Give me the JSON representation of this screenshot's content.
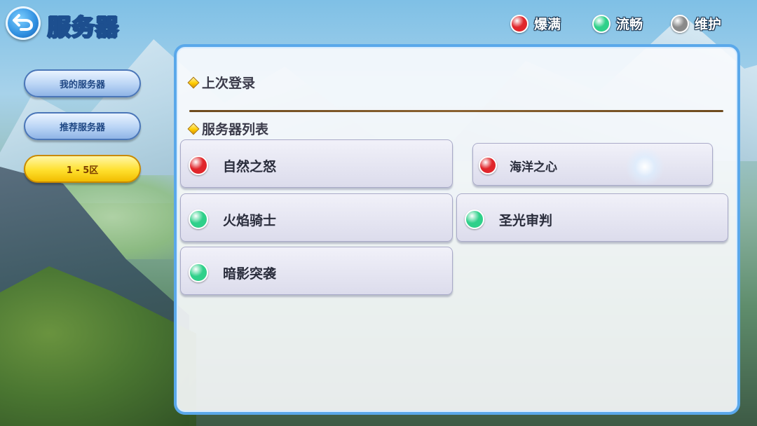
{
  "header": {
    "title": "服务器"
  },
  "legend": [
    {
      "label": "爆满",
      "color": "#e0262b"
    },
    {
      "label": "流畅",
      "color": "#2fd08a"
    },
    {
      "label": "维护",
      "color": "#8a8a8a"
    }
  ],
  "sidebar": {
    "items": [
      {
        "label": "我的服务器",
        "active": false
      },
      {
        "label": "推荐服务器",
        "active": false
      },
      {
        "label": "1 - 5区",
        "active": true
      }
    ]
  },
  "sections": {
    "last_login": "上次登录",
    "server_list": "服务器列表"
  },
  "servers": [
    {
      "name": "自然之怒",
      "status": "爆满",
      "status_color": "#e0262b"
    },
    {
      "name": "海洋之心",
      "status": "爆满",
      "status_color": "#e0262b"
    },
    {
      "name": "火焰骑士",
      "status": "流畅",
      "status_color": "#2fd08a"
    },
    {
      "name": "圣光审判",
      "status": "流畅",
      "status_color": "#2fd08a"
    },
    {
      "name": "暗影突袭",
      "status": "流畅",
      "status_color": "#2fd08a"
    }
  ]
}
